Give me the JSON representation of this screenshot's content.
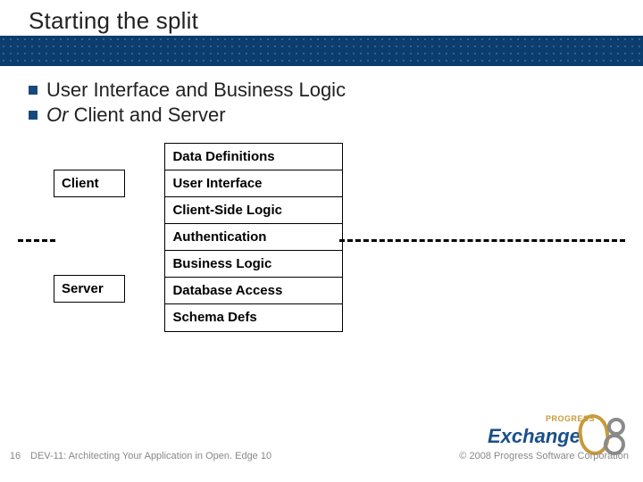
{
  "title": "Starting the split",
  "bullets": {
    "b1": "User Interface and Business Logic",
    "b2_or": "Or",
    "b2_rest": " Client and Server"
  },
  "labels": {
    "client": "Client",
    "server": "Server"
  },
  "stack": {
    "c0": "Data Definitions",
    "c1": "User Interface",
    "c2": "Client-Side Logic",
    "c3": "Authentication",
    "c4": "Business Logic",
    "c5": "Database Access",
    "c6": "Schema Defs"
  },
  "footer": {
    "slide_no": "16",
    "session": "DEV-11: Architecting Your Application in Open. Edge 10",
    "copyright": "© 2008 Progress Software Corporation"
  },
  "logo": {
    "brand": "Exchange",
    "tag": "PROGRESS"
  }
}
